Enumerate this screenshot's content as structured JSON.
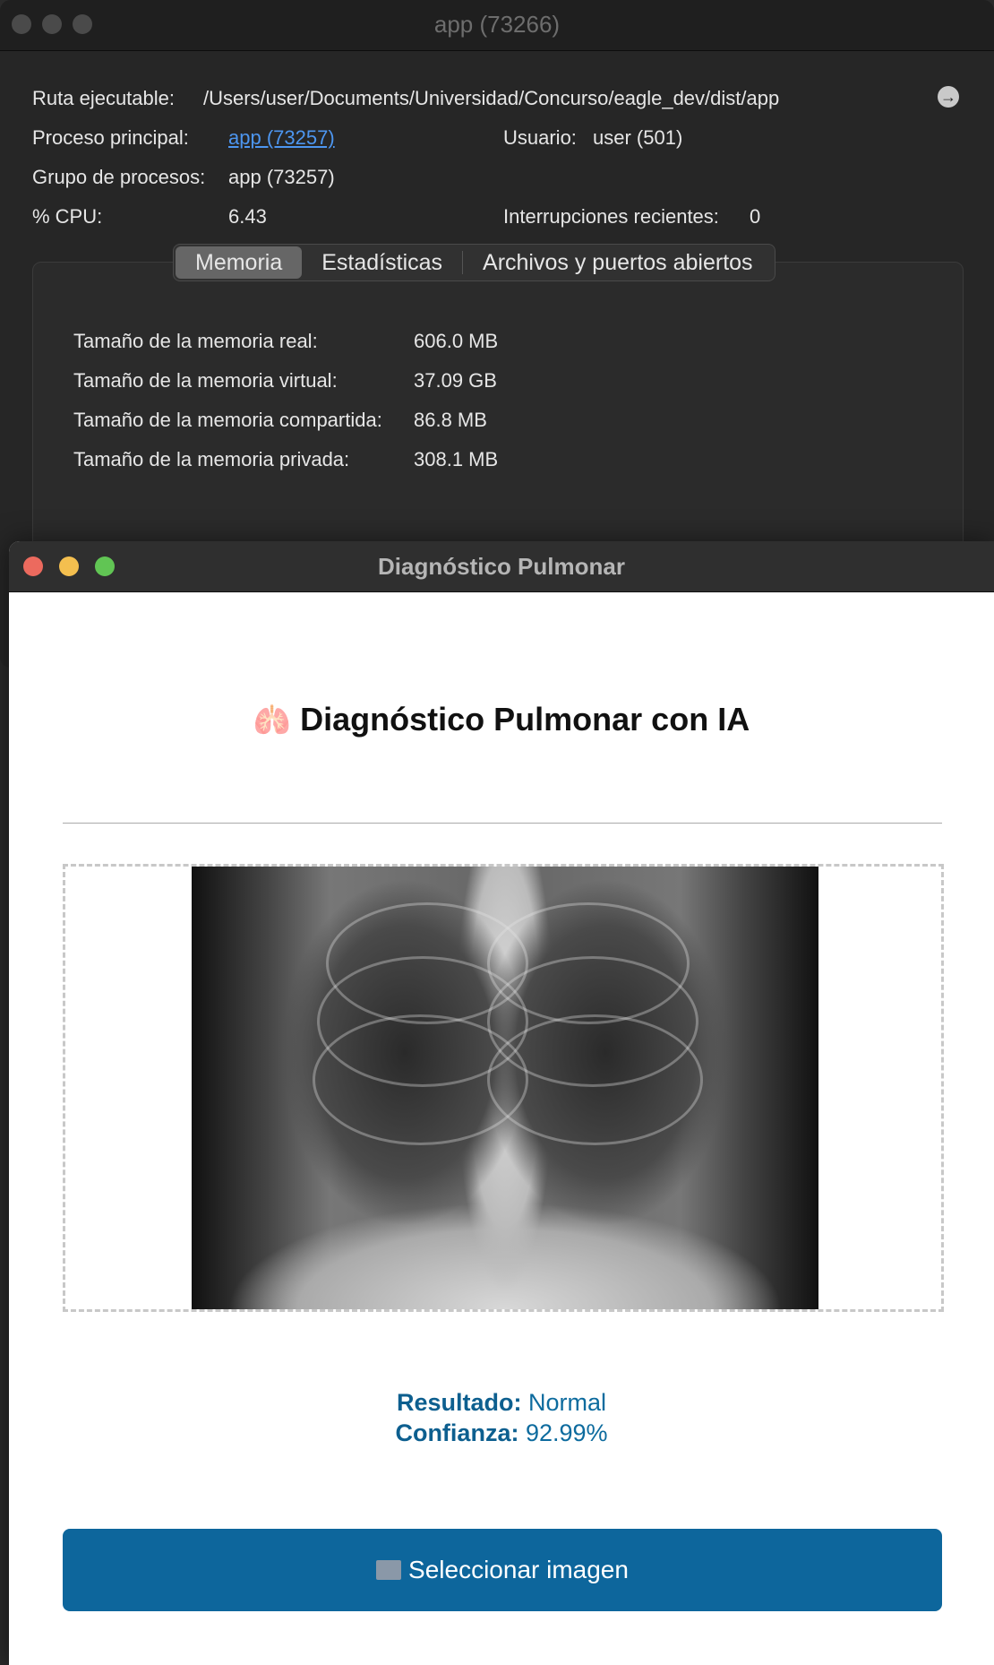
{
  "activity_monitor": {
    "window_title": "app (73266)",
    "executable_label": "Ruta ejecutable:",
    "executable_path": "/Users/user/Documents/Universidad/Concurso/eagle_dev/dist/app",
    "parent_label": "Proceso principal:",
    "parent_value": "app (73257)",
    "user_label": "Usuario:",
    "user_value": "user (501)",
    "group_label": "Grupo de procesos:",
    "group_value": "app (73257)",
    "cpu_label": "% CPU:",
    "cpu_value": "6.43",
    "interrupts_label": "Interrupciones recientes:",
    "interrupts_value": "0",
    "tabs": [
      "Memoria",
      "Estadísticas",
      "Archivos y puertos abiertos"
    ],
    "memory": [
      {
        "label": "Tamaño de la memoria real:",
        "value": "606.0 MB"
      },
      {
        "label": "Tamaño de la memoria virtual:",
        "value": "37.09 GB"
      },
      {
        "label": "Tamaño de la memoria compartida:",
        "value": "86.8 MB"
      },
      {
        "label": "Tamaño de la memoria privada:",
        "value": "308.1 MB"
      }
    ]
  },
  "diagnostic_app": {
    "window_title": "Diagnóstico Pulmonar",
    "heading_icon": "🫁",
    "heading": "Diagnóstico Pulmonar con IA",
    "result_label": "Resultado:",
    "result_value": "Normal",
    "confidence_label": "Confianza:",
    "confidence_value": "92.99%",
    "select_button_label": "Seleccionar imagen",
    "colors": {
      "accent": "#0d669c",
      "result_text": "#0d6b9e",
      "close": "#ec6a5e",
      "minimize": "#f4bf4f",
      "zoom": "#61c554"
    }
  }
}
